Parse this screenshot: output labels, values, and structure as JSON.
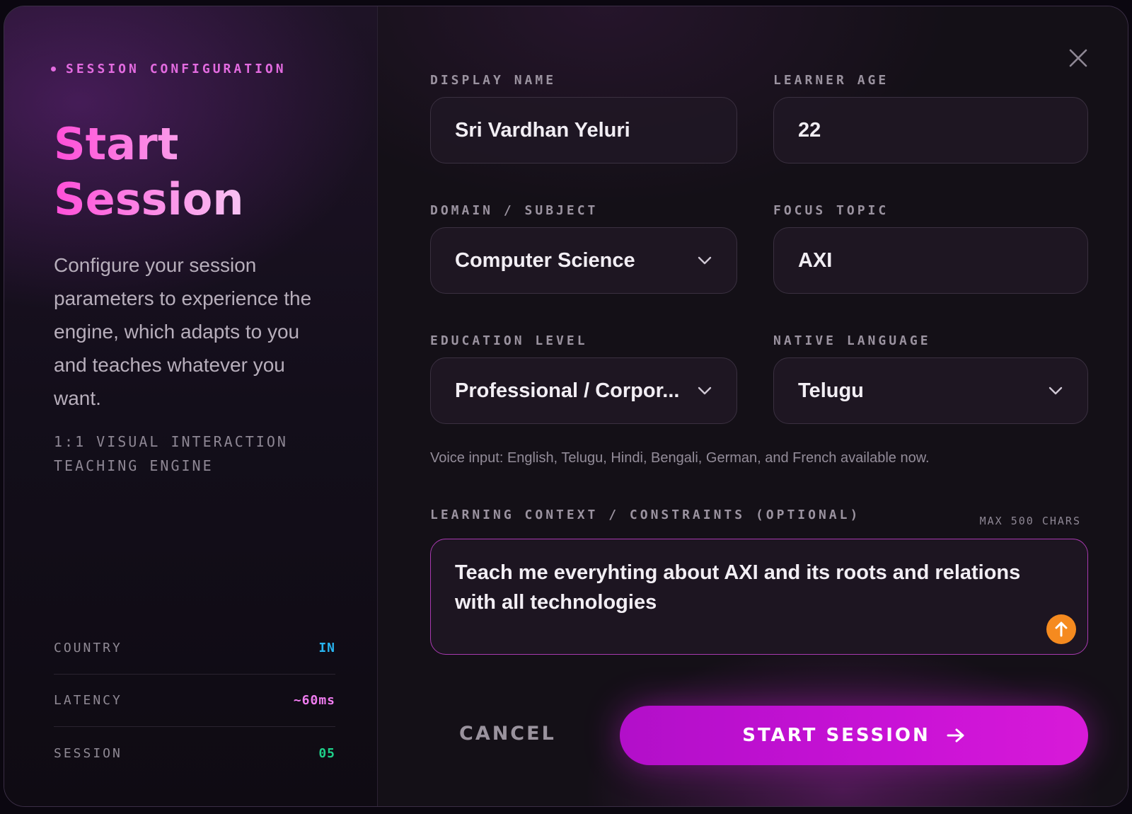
{
  "sidebar": {
    "eyebrow": "SESSION CONFIGURATION",
    "title_line1": "Start",
    "title_line2": "Session",
    "description": "Configure your session parameters to experience the engine, which adapts to you and teaches whatever you want.",
    "tagline": "1:1 VISUAL INTERACTION TEACHING ENGINE",
    "stats": [
      {
        "label": "COUNTRY",
        "value": "IN",
        "color": "#28b4f0"
      },
      {
        "label": "LATENCY",
        "value": "~60ms",
        "color": "#f07cf0"
      },
      {
        "label": "SESSION",
        "value": "05",
        "color": "#1fd08a"
      }
    ]
  },
  "form": {
    "display_name": {
      "label": "DISPLAY NAME",
      "value": "Sri Vardhan Yeluri"
    },
    "learner_age": {
      "label": "LEARNER AGE",
      "value": "22"
    },
    "domain": {
      "label": "DOMAIN / SUBJECT",
      "value": "Computer Science"
    },
    "focus_topic": {
      "label": "FOCUS TOPIC",
      "value": "AXI"
    },
    "education_level": {
      "label": "EDUCATION LEVEL",
      "value": "Professional / Corpor..."
    },
    "native_language": {
      "label": "NATIVE LANGUAGE",
      "value": "Telugu"
    },
    "voice_helper": "Voice input: English, Telugu, Hindi, Bengali, German, and French available now.",
    "context": {
      "label": "LEARNING CONTEXT / CONSTRAINTS (OPTIONAL)",
      "max_chars": "MAX 500 CHARS",
      "value": "Teach me everyhting about AXI and its roots and relations with all technologies"
    }
  },
  "actions": {
    "cancel_label": "CANCEL",
    "start_label": "START SESSION"
  },
  "icons": {
    "close": "close-icon",
    "chevron": "chevron-down-icon",
    "upload": "arrow-up-icon",
    "start_arrow": "arrow-right-icon"
  },
  "colors": {
    "accent": "#c912d6",
    "accent_text": "#e36be0",
    "upload": "#f58a1f"
  }
}
